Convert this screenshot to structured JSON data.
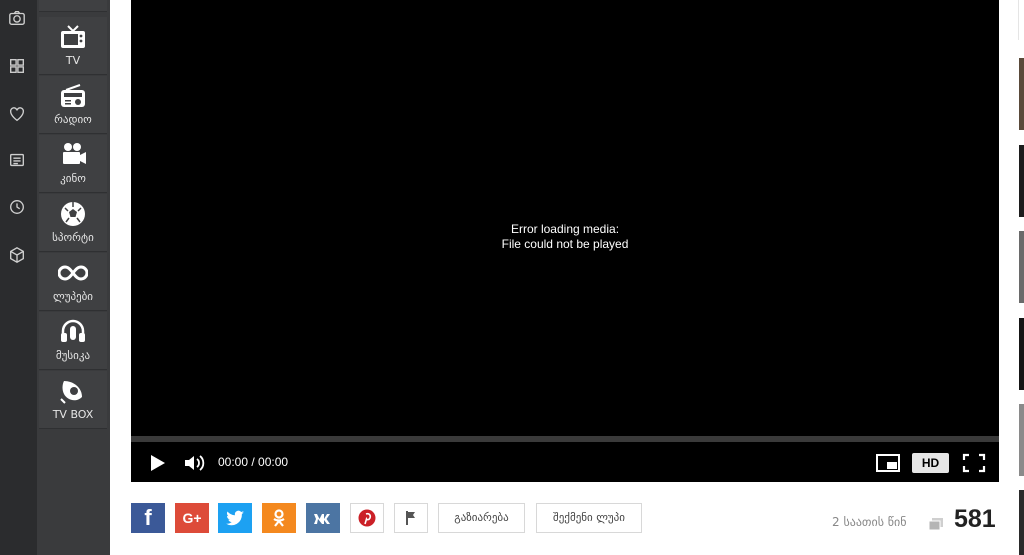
{
  "rail": {
    "icons": [
      "camera-icon",
      "grid-icon",
      "heart-icon",
      "news-icon",
      "clock-icon",
      "box-icon"
    ]
  },
  "categories": [
    {
      "icon": "tv-icon",
      "label": "TV"
    },
    {
      "icon": "radio-icon",
      "label": "რადიო"
    },
    {
      "icon": "movie-camera-icon",
      "label": "კინო"
    },
    {
      "icon": "soccer-ball-icon",
      "label": "სპორტი"
    },
    {
      "icon": "infinity-icon",
      "label": "ლუპები"
    },
    {
      "icon": "headphones-icon",
      "label": "მუსიკა"
    },
    {
      "icon": "tvbox-icon",
      "label": "TV BOX"
    }
  ],
  "player": {
    "error_line1": "Error loading media:",
    "error_line2": "File could not be played",
    "time": "00:00 / 00:00",
    "hd_label": "HD"
  },
  "share": {
    "facebook": "f",
    "googleplus": "G+",
    "share_label": "გაზიარება",
    "embed_label": "შექმენი ლუპი"
  },
  "meta": {
    "time_ago": "2 საათის წინ",
    "views": "581"
  },
  "colors": {
    "facebook": "#3b5998",
    "googleplus": "#dd4b39",
    "twitter": "#1da1f2",
    "odnoklassniki": "#f4891f",
    "vk": "#4c75a3",
    "pinterest": "#cb2027"
  }
}
